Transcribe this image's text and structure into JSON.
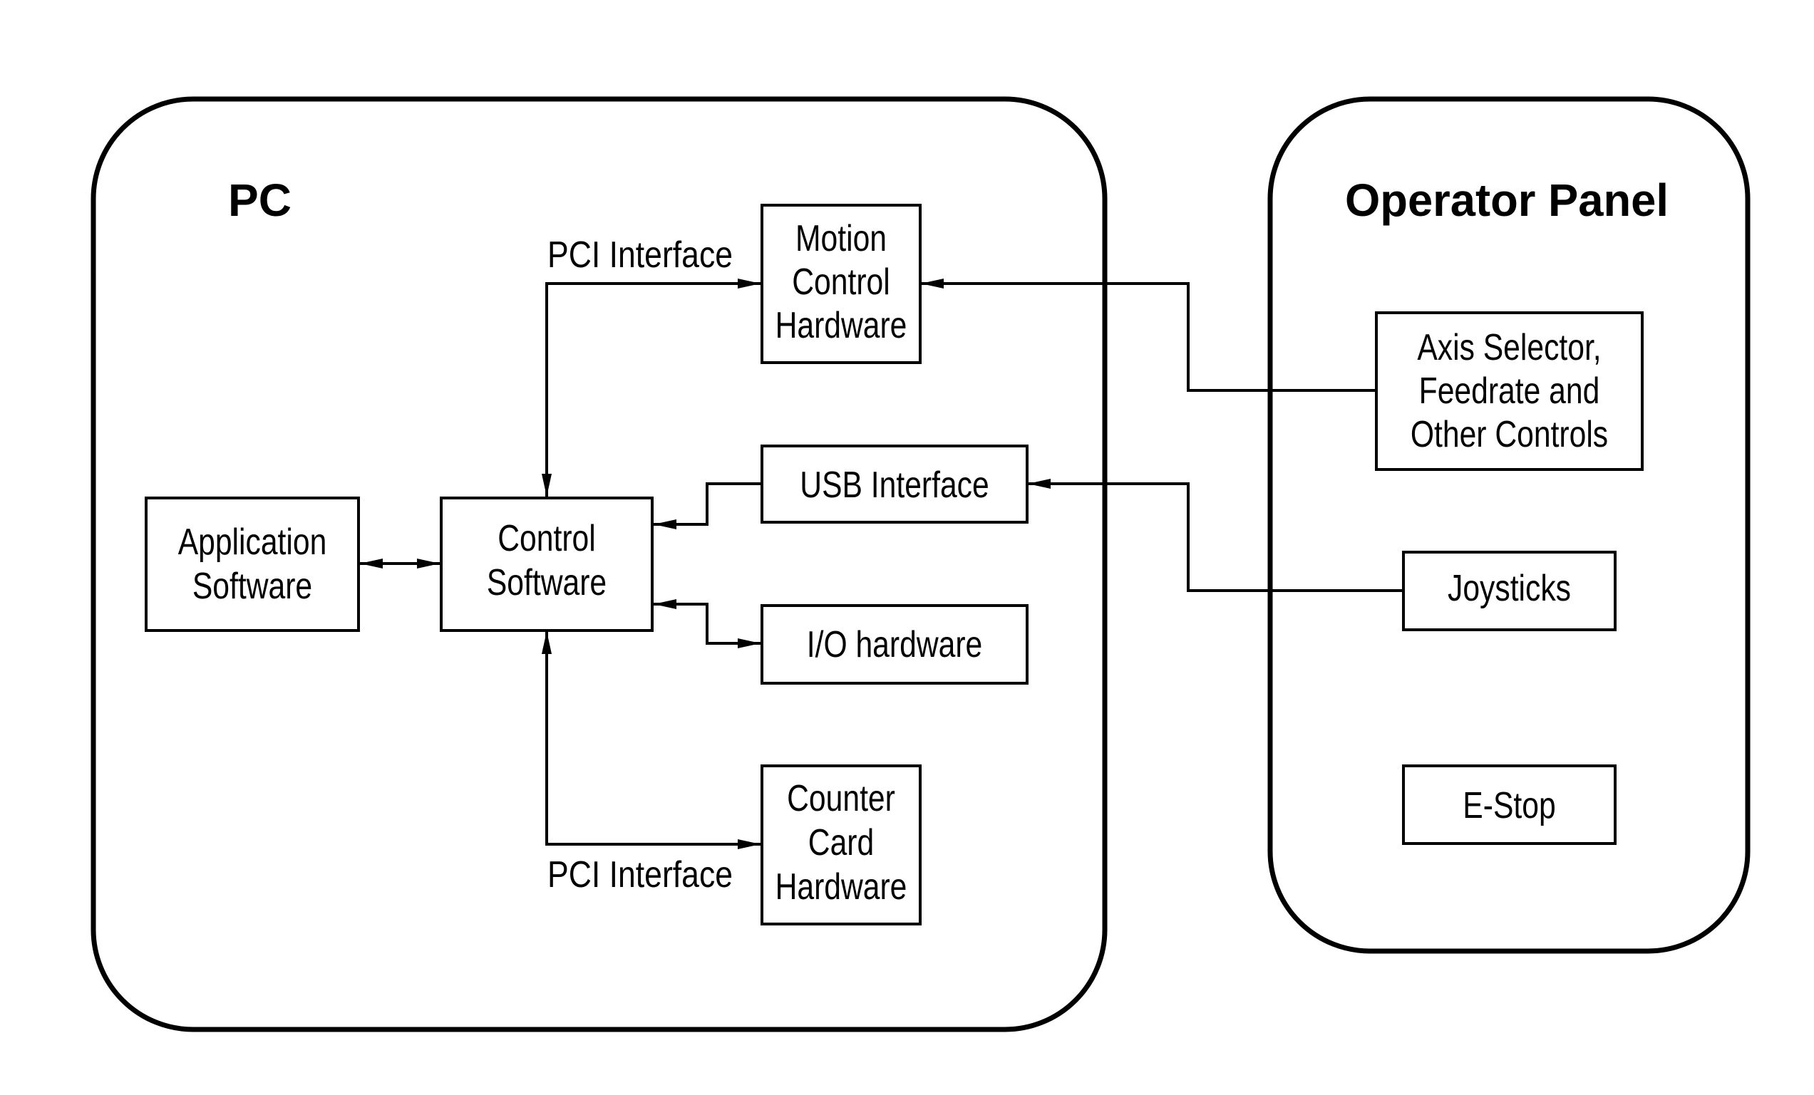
{
  "diagram": {
    "type": "block-diagram",
    "colors": {
      "stroke": "#000000",
      "background": "#ffffff",
      "text": "#000000"
    },
    "containers": [
      {
        "id": "pc",
        "title": "PC"
      },
      {
        "id": "operator_panel",
        "title": "Operator Panel"
      }
    ],
    "nodes": [
      {
        "id": "application_software",
        "container": "pc",
        "lines": [
          "Application",
          "Software"
        ]
      },
      {
        "id": "control_software",
        "container": "pc",
        "lines": [
          "Control",
          "Software"
        ]
      },
      {
        "id": "motion_control_hardware",
        "container": "pc",
        "lines": [
          "Motion",
          "Control",
          "Hardware"
        ]
      },
      {
        "id": "usb_interface",
        "container": "pc",
        "lines": [
          "USB Interface"
        ]
      },
      {
        "id": "io_hardware",
        "container": "pc",
        "lines": [
          "I/O hardware"
        ]
      },
      {
        "id": "counter_card_hardware",
        "container": "pc",
        "lines": [
          "Counter",
          "Card",
          "Hardware"
        ]
      },
      {
        "id": "axis_selector",
        "container": "operator_panel",
        "lines": [
          "Axis Selector,",
          "Feedrate and",
          "Other Controls"
        ]
      },
      {
        "id": "joysticks",
        "container": "operator_panel",
        "lines": [
          "Joysticks"
        ]
      },
      {
        "id": "e_stop",
        "container": "operator_panel",
        "lines": [
          "E-Stop"
        ]
      }
    ],
    "edges": [
      {
        "id": "app_control",
        "from": "application_software",
        "to": "control_software",
        "direction": "bidirectional",
        "label": ""
      },
      {
        "id": "control_motion",
        "from": "control_software",
        "to": "motion_control_hardware",
        "direction": "bidirectional",
        "label": "PCI Interface"
      },
      {
        "id": "usb_control",
        "from": "usb_interface",
        "to": "control_software",
        "direction": "forward",
        "label": ""
      },
      {
        "id": "control_io",
        "from": "control_software",
        "to": "io_hardware",
        "direction": "bidirectional",
        "label": ""
      },
      {
        "id": "control_counter",
        "from": "control_software",
        "to": "counter_card_hardware",
        "direction": "bidirectional",
        "label": "PCI Interface"
      },
      {
        "id": "axis_motion",
        "from": "axis_selector",
        "to": "motion_control_hardware",
        "direction": "forward",
        "label": ""
      },
      {
        "id": "joysticks_usb",
        "from": "joysticks",
        "to": "usb_interface",
        "direction": "forward",
        "label": ""
      }
    ]
  }
}
